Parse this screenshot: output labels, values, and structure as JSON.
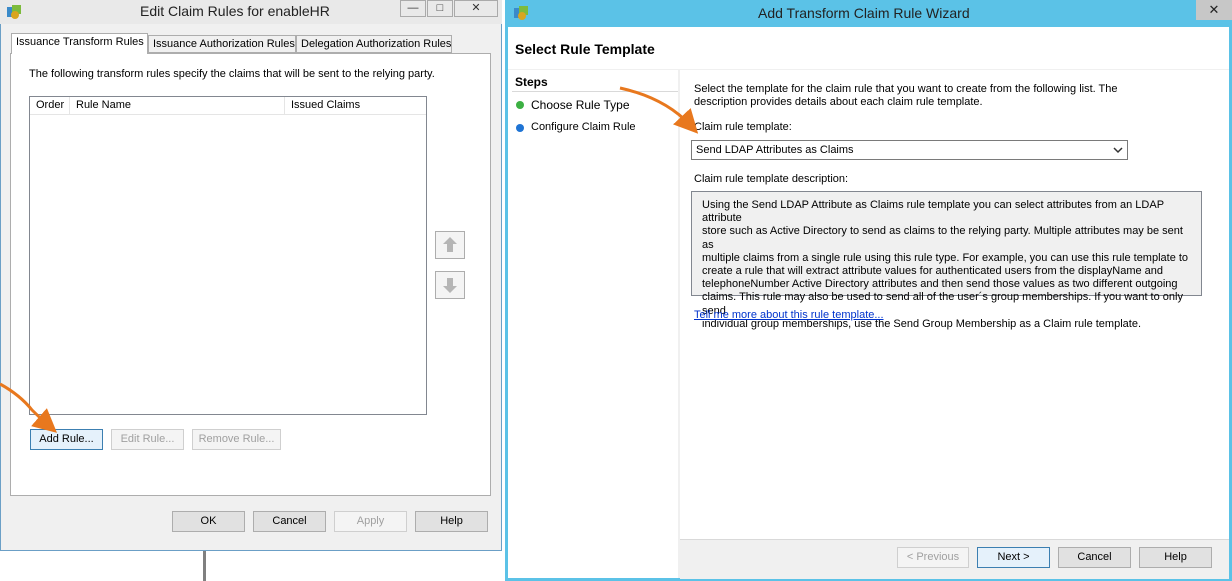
{
  "left_dialog": {
    "title": "Edit Claim Rules for enableHR",
    "caption_minimize": "—",
    "caption_maximize": "□",
    "caption_close": "✕",
    "tabs": [
      "Issuance Transform Rules",
      "Issuance Authorization Rules",
      "Delegation Authorization Rules"
    ],
    "description": "The following transform rules specify the claims that will be sent to the relying party.",
    "columns": [
      "Order",
      "Rule Name",
      "Issued Claims"
    ],
    "add_rule": "Add Rule...",
    "edit_rule": "Edit Rule...",
    "remove_rule": "Remove Rule...",
    "ok": "OK",
    "cancel": "Cancel",
    "apply": "Apply",
    "help": "Help"
  },
  "wizard": {
    "title": "Add Transform Claim Rule Wizard",
    "close": "✕",
    "page_title": "Select Rule Template",
    "steps_header": "Steps",
    "steps": [
      {
        "label": "Choose Rule Type",
        "color": "#3cb043"
      },
      {
        "label": "Configure Claim Rule",
        "color": "#1f74d4"
      }
    ],
    "intro": "Select the template for the claim rule that you want to create from the following list. The description provides details about each claim rule template.",
    "template_label": "Claim rule template:",
    "template_value": "Send LDAP Attributes as Claims",
    "desc_label": "Claim rule template description:",
    "desc_lines": [
      "Using the Send LDAP Attribute as Claims rule template you can select attributes from an LDAP attribute",
      "store such as Active Directory to send as claims to the relying party. Multiple attributes may be sent as",
      "multiple claims from a single rule using this rule type. For example, you can use this rule template to",
      "create a rule that will extract attribute values for authenticated users from the displayName and",
      "telephoneNumber Active Directory attributes and then send those values as two different outgoing",
      "claims. This rule may also be used to send all of the user´s group memberships. If you want to only send",
      "individual group memberships, use the Send Group Membership as a Claim rule template."
    ],
    "more_link": "Tell me more about this rule template...",
    "previous": "< Previous",
    "next": "Next >",
    "cancel": "Cancel",
    "help": "Help"
  },
  "colors": {
    "wizard_frame": "#5bc2e7",
    "annotation_arrow": "#e8781e",
    "link": "#0033cc"
  }
}
